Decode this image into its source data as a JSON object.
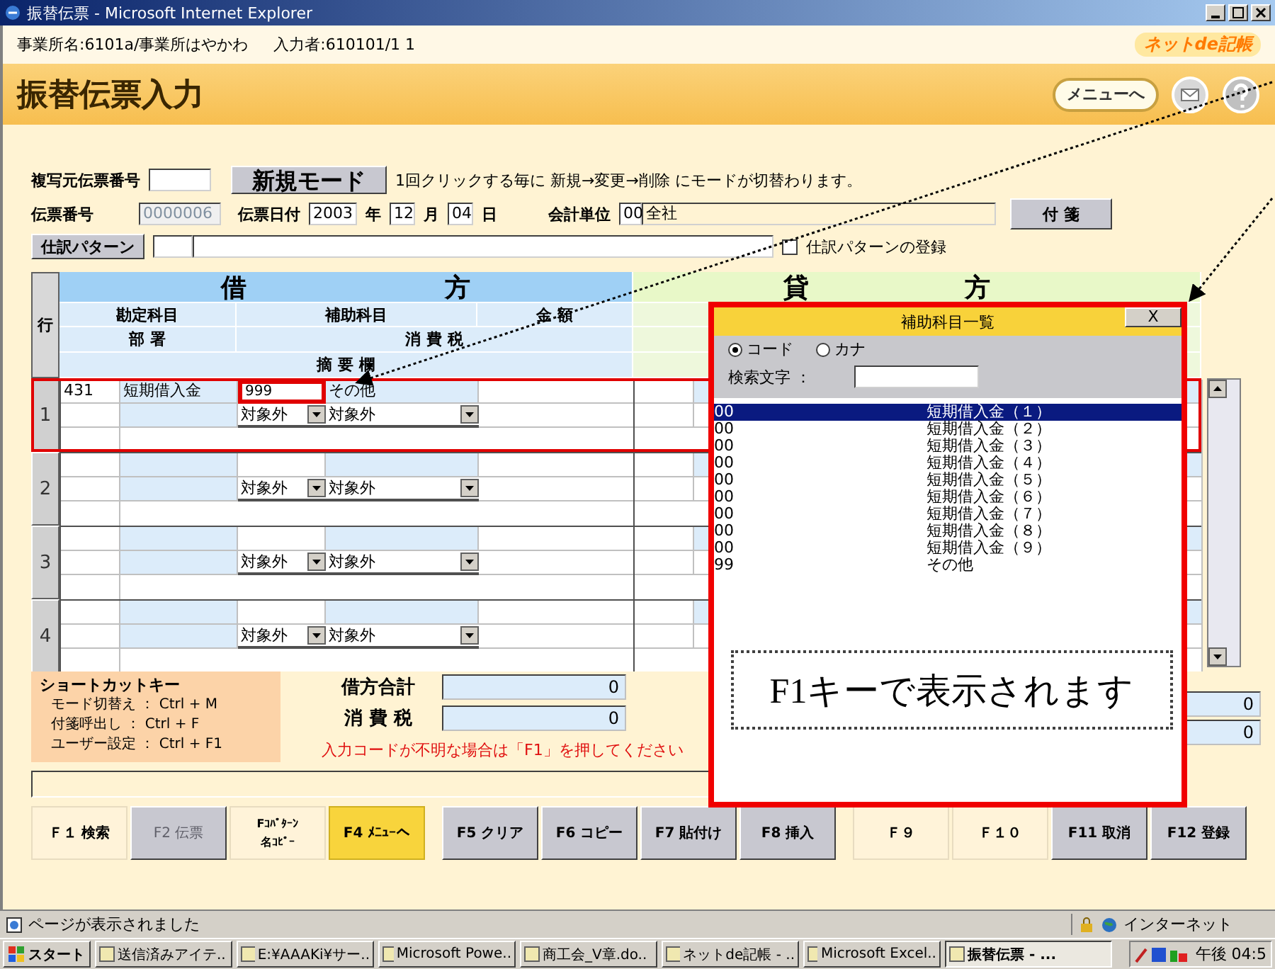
{
  "window": {
    "title": "振替伝票 - Microsoft Internet Explorer"
  },
  "info_bar": {
    "office": "事業所名:6101a/事業所はやかわ",
    "user": "入力者:610101/1 1",
    "logo": "ネットde記帳"
  },
  "header": {
    "title": "振替伝票入力",
    "menu_button": "メニューへ"
  },
  "form": {
    "copy_source_label": "複写元伝票番号",
    "mode_button": "新規モード",
    "mode_hint": "1回クリックする毎に 新規→変更→削除 にモードが切替わります。",
    "slip_no_label": "伝票番号",
    "slip_no": "0000006",
    "date_label": "伝票日付",
    "year": "2003",
    "year_unit": "年",
    "month": "12",
    "month_unit": "月",
    "day": "04",
    "day_unit": "日",
    "unit_label": "会計単位",
    "unit_code": "00",
    "unit_name": "全社",
    "sticky_button": "付 箋",
    "pattern_button": "仕訳パターン",
    "pattern_register": {
      "label": "仕訳パターンの登録",
      "checked": false
    }
  },
  "grid": {
    "row_header": "行",
    "debit_title": [
      "借",
      "方"
    ],
    "credit_title": [
      "貸",
      "方"
    ],
    "debit_columns": {
      "account": "勘定科目",
      "sub_account": "補助科目",
      "amount": "金 額",
      "dept": "部 署",
      "tax": "消 費 税",
      "memo": "摘 要 欄"
    },
    "rows": [
      {
        "no": "1",
        "code": "431",
        "account": "短期借入金",
        "sub_code": "999",
        "sub_name": "その他",
        "tax_type": "対象外",
        "tax_rate": "対象外",
        "highlighted": true,
        "sub_code_marked": true
      },
      {
        "no": "2",
        "tax_type": "対象外",
        "tax_rate": "対象外",
        "highlighted": false,
        "sub_code_marked": false
      },
      {
        "no": "3",
        "tax_type": "対象外",
        "tax_rate": "対象外",
        "highlighted": false,
        "sub_code_marked": false
      },
      {
        "no": "4",
        "tax_type": "対象外",
        "tax_rate": "対象外",
        "highlighted": false,
        "sub_code_marked": false
      }
    ]
  },
  "shortcuts": {
    "title": "ショートカットキー",
    "lines": [
      "モード切替え ： Ctrl + M",
      "付箋呼出し ： Ctrl + F",
      "ユーザー設定 ： Ctrl + F1"
    ]
  },
  "totals": {
    "debit_label": "借方合計",
    "debit_total": "0",
    "tax_label": "消 費 税",
    "tax_total": "0",
    "credit_total": "0",
    "credit_tax": "0"
  },
  "message": "入力コードが不明な場合は「F1」を押してください",
  "function_keys": [
    {
      "label": "Ｆ１ 検索",
      "kind": "plain"
    },
    {
      "label": "F2 伝票",
      "kind": "disabled"
    },
    {
      "label": "Fｺﾊﾟﾀｰﾝ名ｺﾋﾟｰ",
      "kind": "small"
    },
    {
      "label": "F4 ﾒﾆｭｰへ",
      "kind": "highlight"
    },
    {
      "label": "F5 クリア",
      "kind": "gray"
    },
    {
      "label": "F6 コピー",
      "kind": "gray"
    },
    {
      "label": "F7 貼付け",
      "kind": "gray"
    },
    {
      "label": "F8 挿入",
      "kind": "gray"
    },
    {
      "label": "Ｆ９",
      "kind": "plain"
    },
    {
      "label": "Ｆ１０",
      "kind": "plain"
    },
    {
      "label": "F11 取消",
      "kind": "gray"
    },
    {
      "label": "F12 登録",
      "kind": "gray"
    }
  ],
  "popup": {
    "title": "補助科目一覧",
    "close": "X",
    "radios": [
      {
        "label": "コード",
        "selected": true
      },
      {
        "label": "カナ",
        "selected": false
      }
    ],
    "search_label": "検索文字 ：",
    "items": [
      {
        "code": "00",
        "name": "短期借入金（１）",
        "selected": true
      },
      {
        "code": "00",
        "name": "短期借入金（２）",
        "selected": false
      },
      {
        "code": "00",
        "name": "短期借入金（３）",
        "selected": false
      },
      {
        "code": "00",
        "name": "短期借入金（４）",
        "selected": false
      },
      {
        "code": "00",
        "name": "短期借入金（５）",
        "selected": false
      },
      {
        "code": "00",
        "name": "短期借入金（６）",
        "selected": false
      },
      {
        "code": "00",
        "name": "短期借入金（７）",
        "selected": false
      },
      {
        "code": "00",
        "name": "短期借入金（８）",
        "selected": false
      },
      {
        "code": "00",
        "name": "短期借入金（９）",
        "selected": false
      },
      {
        "code": "99",
        "name": "その他",
        "selected": false
      }
    ],
    "note": "F1キーで表示されます"
  },
  "status_bar": {
    "text": "ページが表示されました",
    "zone": "インターネット"
  },
  "taskbar": {
    "start": "スタート",
    "items": [
      {
        "label": "送信済みアイテ..",
        "selected": false
      },
      {
        "label": "E:¥AAAKi¥サー..",
        "selected": false
      },
      {
        "label": "Microsoft Powe..",
        "selected": false
      },
      {
        "label": "商工会_V章.do..",
        "selected": false
      },
      {
        "label": "ネットde記帳 - ..",
        "selected": false
      },
      {
        "label": "Microsoft Excel..",
        "selected": false
      },
      {
        "label": "振替伝票 - ...",
        "selected": true
      }
    ],
    "clock": "午後 04:5"
  }
}
